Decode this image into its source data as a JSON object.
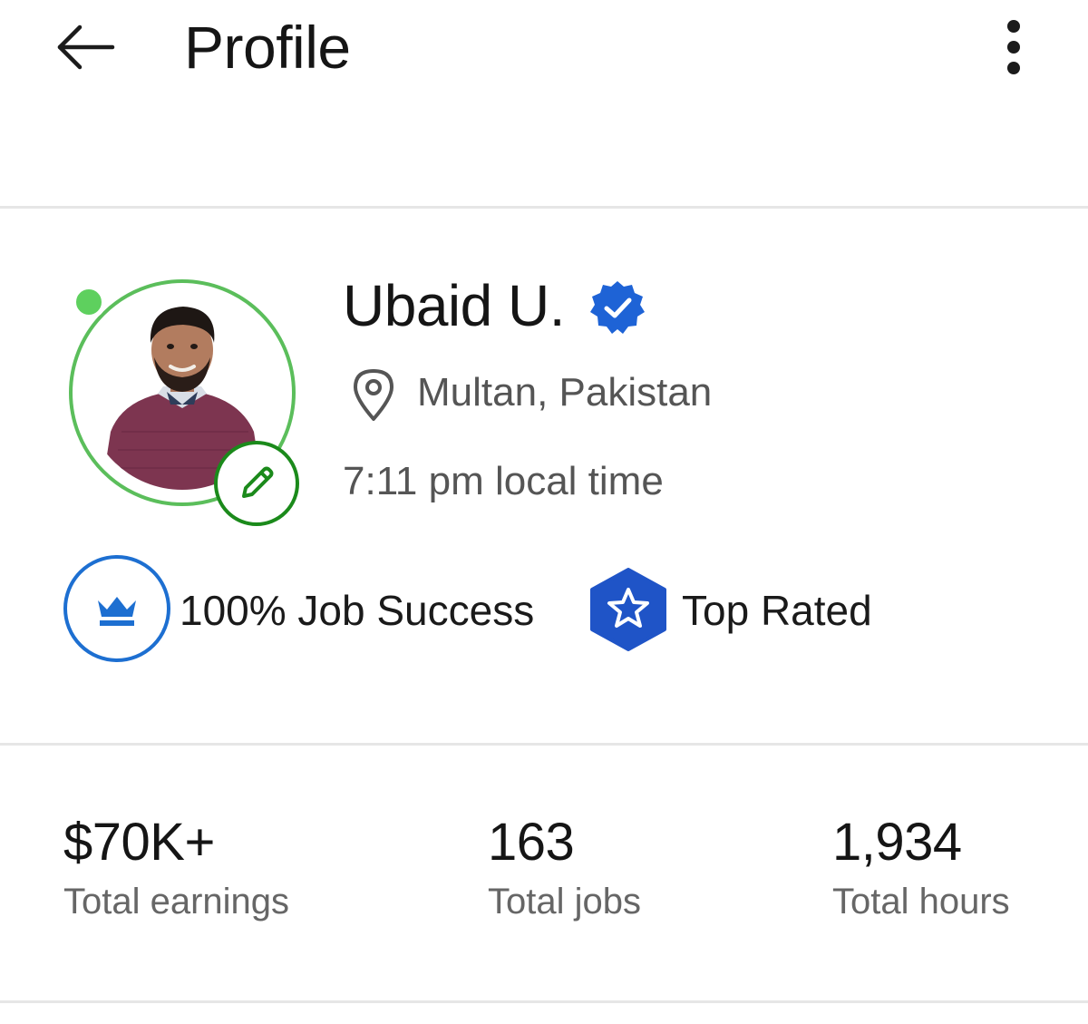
{
  "header": {
    "title": "Profile",
    "back_icon": "arrow-left-icon",
    "more_icon": "more-vertical-icon"
  },
  "profile": {
    "name": "Ubaid U.",
    "verified_icon": "verified-badge-icon",
    "location": "Multan, Pakistan",
    "location_icon": "map-pin-icon",
    "local_time": "7:11 pm local time",
    "status": "online",
    "edit_icon": "pencil-icon"
  },
  "badges": [
    {
      "icon": "crown-icon",
      "label": "100% Job Success"
    },
    {
      "icon": "star-hexagon-icon",
      "label": "Top Rated"
    }
  ],
  "stats": [
    {
      "value": "$70K+",
      "label": "Total earnings"
    },
    {
      "value": "163",
      "label": "Total jobs"
    },
    {
      "value": "1,934",
      "label": "Total hours"
    }
  ],
  "colors": {
    "online": "#5ed05e",
    "ring": "#5bbe5b",
    "edit": "#1b8a1b",
    "brand_blue": "#1d6fd1",
    "top_rated_blue": "#1f54c7"
  }
}
